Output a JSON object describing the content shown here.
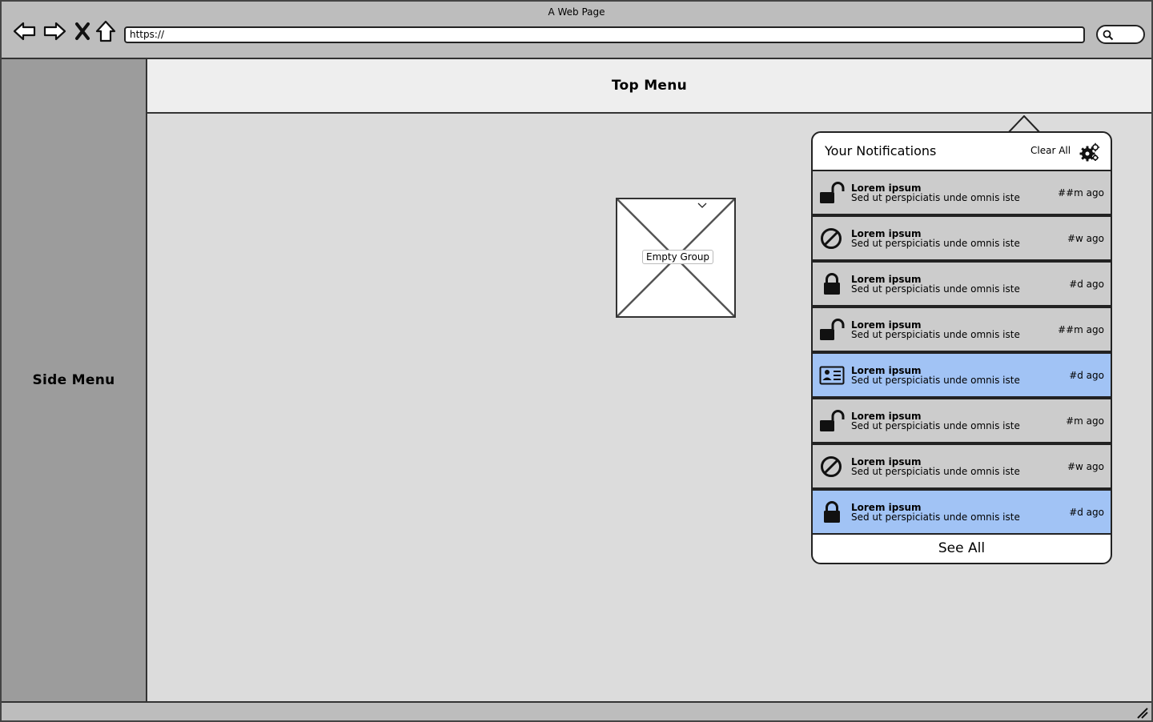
{
  "browser": {
    "window_title": "A Web Page",
    "url": "https://"
  },
  "side_menu": {
    "label": "Side Menu"
  },
  "top_menu": {
    "label": "Top Menu"
  },
  "empty_group": {
    "label": "Empty Group"
  },
  "notifications": {
    "title": "Your Notifications",
    "clear_all": "Clear All",
    "see_all": "See All",
    "items": [
      {
        "icon": "unlock-icon",
        "title": "Lorem ipsum",
        "text": "Sed ut perspiciatis unde omnis iste",
        "time": "##m ago",
        "highlight": false
      },
      {
        "icon": "ban-icon",
        "title": "Lorem ipsum",
        "text": "Sed ut perspiciatis unde omnis iste",
        "time": "#w ago",
        "highlight": false
      },
      {
        "icon": "lock-icon",
        "title": "Lorem ipsum",
        "text": "Sed ut perspiciatis unde omnis iste",
        "time": "#d ago",
        "highlight": false
      },
      {
        "icon": "unlock-icon",
        "title": "Lorem ipsum",
        "text": "Sed ut perspiciatis unde omnis iste",
        "time": "##m ago",
        "highlight": false
      },
      {
        "icon": "id-card-icon",
        "title": "Lorem ipsum",
        "text": "Sed ut perspiciatis unde omnis iste",
        "time": "#d ago",
        "highlight": true
      },
      {
        "icon": "unlock-icon",
        "title": "Lorem ipsum",
        "text": "Sed ut perspiciatis unde omnis iste",
        "time": "#m ago",
        "highlight": false
      },
      {
        "icon": "ban-icon",
        "title": "Lorem ipsum",
        "text": "Sed ut perspiciatis unde omnis iste",
        "time": "#w ago",
        "highlight": false
      },
      {
        "icon": "lock-icon",
        "title": "Lorem ipsum",
        "text": "Sed ut perspiciatis unde omnis iste",
        "time": "#d ago",
        "highlight": true
      }
    ]
  },
  "colors": {
    "highlight": "#a1c3f5",
    "item_background": "#cccccc",
    "side_menu": "#9c9c9c",
    "content": "#dcdcdc"
  }
}
